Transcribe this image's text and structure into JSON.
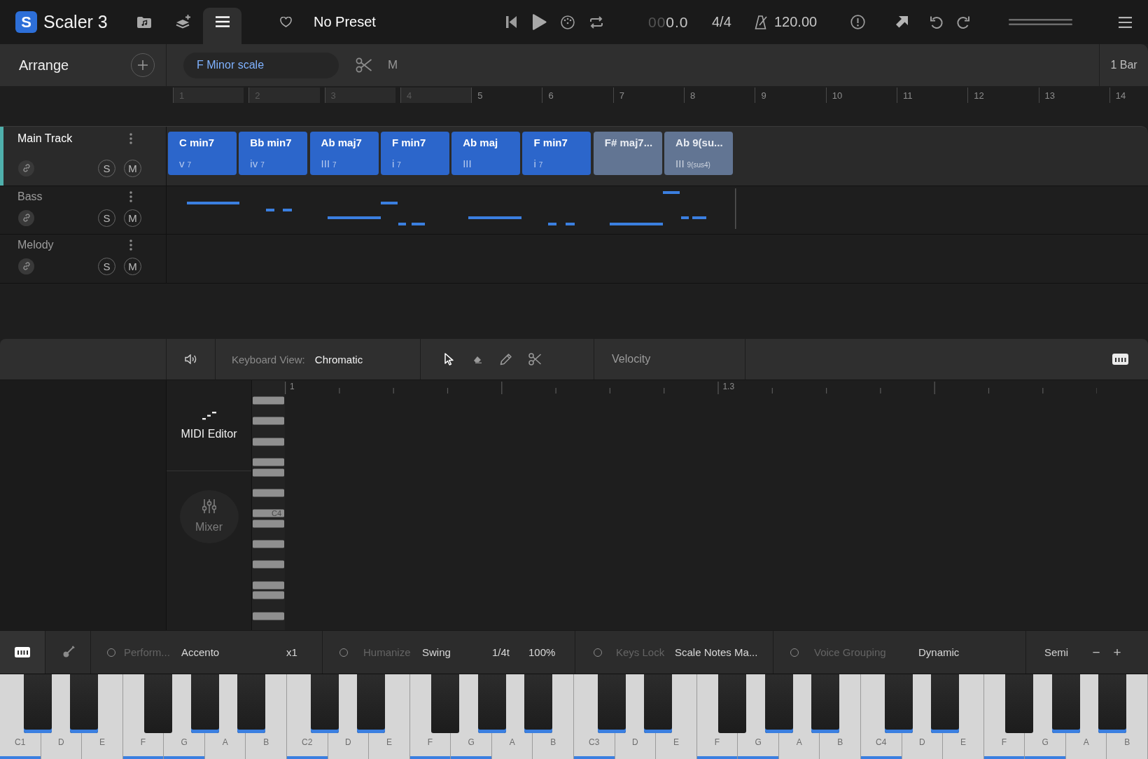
{
  "header": {
    "logo_mark": "S",
    "app_name": "Scaler 3",
    "tabs": [
      {
        "kind": "files",
        "selected": false
      },
      {
        "kind": "layers",
        "selected": false
      },
      {
        "kind": "menu",
        "selected": true
      }
    ],
    "preset": "No Preset",
    "position": {
      "dim": "00",
      "value": "0.0"
    },
    "time_signature": "4/4",
    "tempo": "120.00"
  },
  "arrange": {
    "title": "Arrange",
    "scale": "F Minor scale",
    "mode": "M",
    "length": "1 Bar"
  },
  "ruler": [
    {
      "label": "1",
      "in_loop": true
    },
    {
      "label": "2",
      "in_loop": true
    },
    {
      "label": "3",
      "in_loop": true
    },
    {
      "label": "4",
      "in_loop": true
    },
    {
      "label": "5",
      "in_loop": false
    },
    {
      "label": "6",
      "in_loop": false
    },
    {
      "label": "7",
      "in_loop": false
    },
    {
      "label": "8",
      "in_loop": false
    },
    {
      "label": "9",
      "in_loop": false
    },
    {
      "label": "10",
      "in_loop": false
    },
    {
      "label": "11",
      "in_loop": false
    },
    {
      "label": "12",
      "in_loop": false
    },
    {
      "label": "13",
      "in_loop": false
    },
    {
      "label": "14",
      "in_loop": false
    }
  ],
  "tracks": [
    {
      "name": "Main Track",
      "kind": "chords",
      "selected": true,
      "solo": "S",
      "mute": "M",
      "chords": [
        {
          "name": "C min7",
          "degree": "v",
          "extension": "7",
          "in_scale": true
        },
        {
          "name": "Bb min7",
          "degree": "iv",
          "extension": "7",
          "in_scale": true
        },
        {
          "name": "Ab maj7",
          "degree": "III",
          "extension": "7",
          "in_scale": true
        },
        {
          "name": "F min7",
          "degree": "i",
          "extension": "7",
          "in_scale": true
        },
        {
          "name": "Ab maj",
          "degree": "III",
          "in_scale": true
        },
        {
          "name": "F min7",
          "degree": "i",
          "extension": "7",
          "in_scale": true
        },
        {
          "name": "F# maj7...",
          "in_scale": false
        },
        {
          "name": "Ab 9(su...",
          "degree": "III",
          "extension": "9(sus4)",
          "in_scale": false
        }
      ]
    },
    {
      "name": "Bass",
      "kind": "midi",
      "selected": false,
      "solo": "S",
      "mute": "M"
    },
    {
      "name": "Melody",
      "kind": "empty",
      "selected": false,
      "solo": "S",
      "mute": "M"
    }
  ],
  "editor": {
    "keyboard_view_label": "Keyboard View:",
    "keyboard_view": "Chromatic",
    "tools": [
      {
        "kind": "pointer",
        "selected": true
      },
      {
        "kind": "eraser",
        "selected": false
      },
      {
        "kind": "pencil",
        "selected": false
      },
      {
        "kind": "scissors",
        "selected": false
      }
    ],
    "lane": "Velocity",
    "views": [
      {
        "kind": "midi",
        "label": "MIDI Editor",
        "selected": true
      },
      {
        "kind": "mixer",
        "label": "Mixer",
        "selected": false
      }
    ],
    "key_label": "C4",
    "ruler_labels": [
      "1",
      "1.3"
    ]
  },
  "bottom_bar": {
    "instruments": [
      {
        "kind": "keyboard",
        "selected": true
      },
      {
        "kind": "guitar",
        "selected": false
      }
    ],
    "options": [
      {
        "label": "Perform...",
        "on": false,
        "value": "Accento",
        "extras": [
          "x1"
        ]
      },
      {
        "label": "Humanize",
        "on": false,
        "value": "Swing",
        "extras": [
          "1/4t",
          "100%"
        ]
      },
      {
        "label": "Keys Lock",
        "on": false,
        "value": "Scale Notes Ma..."
      },
      {
        "label": "Voice Grouping",
        "on": false,
        "value": "Dynamic"
      }
    ],
    "transpose": {
      "label": "Semi",
      "decrease": "−",
      "increase": "+"
    }
  },
  "piano": {
    "octaves": [
      {
        "white": [
          {
            "label": "C1",
            "marked": true
          },
          {
            "label": "D",
            "marked": false
          },
          {
            "label": "E",
            "marked": false
          },
          {
            "label": "F",
            "marked": true
          },
          {
            "label": "G",
            "marked": true
          },
          {
            "label": "A",
            "marked": false
          },
          {
            "label": "B",
            "marked": false
          }
        ],
        "black": [
          {
            "marked": true
          },
          {
            "marked": true
          },
          {
            "marked": false
          },
          {
            "marked": true
          },
          {
            "marked": true
          }
        ]
      },
      {
        "white": [
          {
            "label": "C2",
            "marked": true
          },
          {
            "label": "D",
            "marked": false
          },
          {
            "label": "E",
            "marked": false
          },
          {
            "label": "F",
            "marked": true
          },
          {
            "label": "G",
            "marked": true
          },
          {
            "label": "A",
            "marked": false
          },
          {
            "label": "B",
            "marked": false
          }
        ],
        "black": [
          {
            "marked": true
          },
          {
            "marked": true
          },
          {
            "marked": false
          },
          {
            "marked": true
          },
          {
            "marked": true
          }
        ]
      },
      {
        "white": [
          {
            "label": "C3",
            "marked": true
          },
          {
            "label": "D",
            "marked": false
          },
          {
            "label": "E",
            "marked": false
          },
          {
            "label": "F",
            "marked": true
          },
          {
            "label": "G",
            "marked": true
          },
          {
            "label": "A",
            "marked": false
          },
          {
            "label": "B",
            "marked": false
          }
        ],
        "black": [
          {
            "marked": true
          },
          {
            "marked": true
          },
          {
            "marked": false
          },
          {
            "marked": true
          },
          {
            "marked": true
          }
        ]
      },
      {
        "white": [
          {
            "label": "C4",
            "marked": true
          },
          {
            "label": "D",
            "marked": false
          },
          {
            "label": "E",
            "marked": false
          },
          {
            "label": "F",
            "marked": true
          },
          {
            "label": "G",
            "marked": true
          },
          {
            "label": "A",
            "marked": false
          },
          {
            "label": "B",
            "marked": false
          }
        ],
        "black": [
          {
            "marked": true
          },
          {
            "marked": true
          },
          {
            "marked": false
          },
          {
            "marked": true
          },
          {
            "marked": true
          }
        ]
      }
    ]
  }
}
